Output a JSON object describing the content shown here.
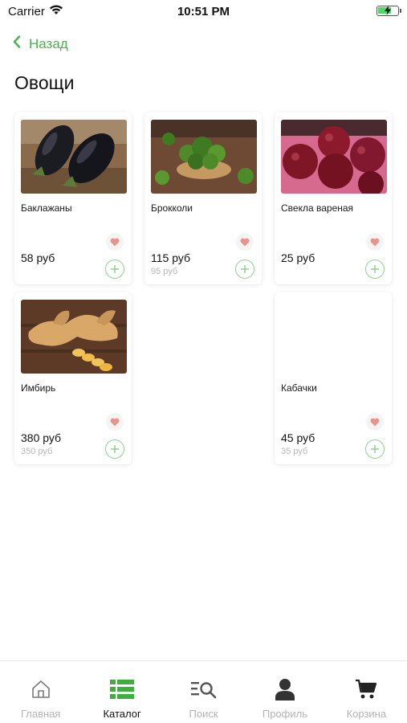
{
  "status_bar": {
    "carrier": "Carrier",
    "time": "10:51 PM",
    "battery_level": 0.7
  },
  "nav": {
    "back_label": "Назад"
  },
  "page_title": "Овощи",
  "products": [
    {
      "name": "Баклажаны",
      "price": "58 руб",
      "old_price": "",
      "image": "eggplant"
    },
    {
      "name": "Брокколи",
      "price": "115 руб",
      "old_price": "95 руб",
      "image": "broccoli"
    },
    {
      "name": "Свекла вареная",
      "price": "25 руб",
      "old_price": "",
      "image": "beet"
    },
    {
      "name": "Имбирь",
      "price": "380 руб",
      "old_price": "350 руб",
      "image": "ginger"
    },
    {
      "name": "Кабачки",
      "price": "45 руб",
      "old_price": "35 руб",
      "image": ""
    }
  ],
  "tabs": [
    {
      "label": "Главная",
      "icon": "home-icon",
      "active": false
    },
    {
      "label": "Каталог",
      "icon": "catalog-icon",
      "active": true
    },
    {
      "label": "Поиск",
      "icon": "search-icon",
      "active": false
    },
    {
      "label": "Профиль",
      "icon": "profile-icon",
      "active": false
    },
    {
      "label": "Корзина",
      "icon": "cart-icon",
      "active": false
    }
  ],
  "colors": {
    "accent": "#4caf50",
    "heart": "#e9948a",
    "add_border": "#8fd28f",
    "muted": "#b3b3b3"
  }
}
